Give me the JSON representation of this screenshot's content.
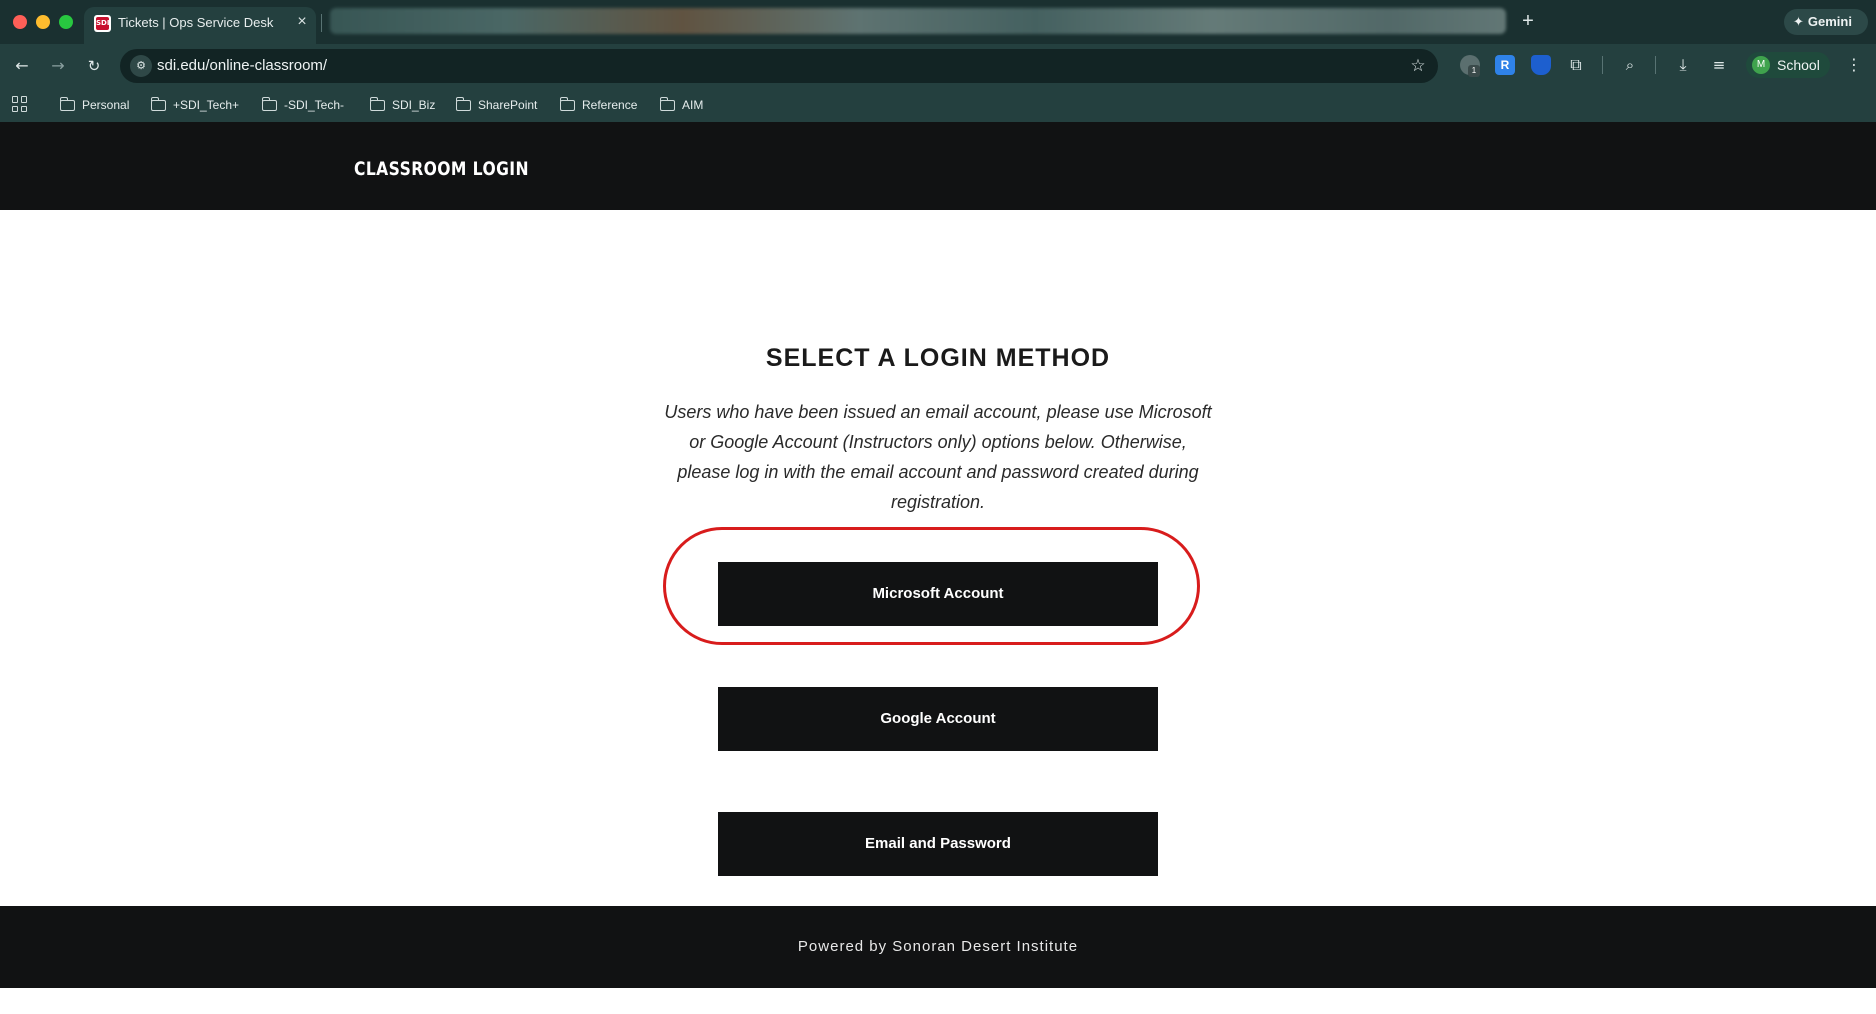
{
  "browser": {
    "active_tab": {
      "title": "Tickets | Ops Service Desk",
      "favicon_text": "SDI"
    },
    "new_tab_label": "+",
    "gemini_label": "Gemini",
    "url": "sdi.edu/online-classroom/",
    "extension_badge": "1",
    "extension_r_label": "R",
    "profile": {
      "initial": "M",
      "name": "School"
    },
    "bookmarks": [
      "Personal",
      "+SDI_Tech+",
      "-SDI_Tech-",
      "SDI_Biz",
      "SharePoint",
      "Reference",
      "AIM"
    ]
  },
  "icons": {
    "back": "back-arrow-icon",
    "forward": "forward-arrow-icon",
    "reload": "reload-icon",
    "site_info": "site-info-icon",
    "bookmark_star": "star-icon",
    "apps": "apps-grid-icon",
    "folder": "folder-icon",
    "menu": "kebab-menu-icon"
  },
  "page": {
    "header_title": "CLASSROOM LOGIN",
    "heading": "SELECT A LOGIN METHOD",
    "description": "Users who have been issued an email account, please use Microsoft or Google Account (Instructors only) options below. Otherwise, please log in with the email account and password created during registration.",
    "buttons": {
      "microsoft": "Microsoft Account",
      "google": "Google Account",
      "email": "Email and Password"
    },
    "footer": "Powered by Sonoran Desert Institute"
  },
  "colors": {
    "highlight": "#d81c1c",
    "button_bg": "#111213",
    "chrome_bg": "#24403f"
  }
}
